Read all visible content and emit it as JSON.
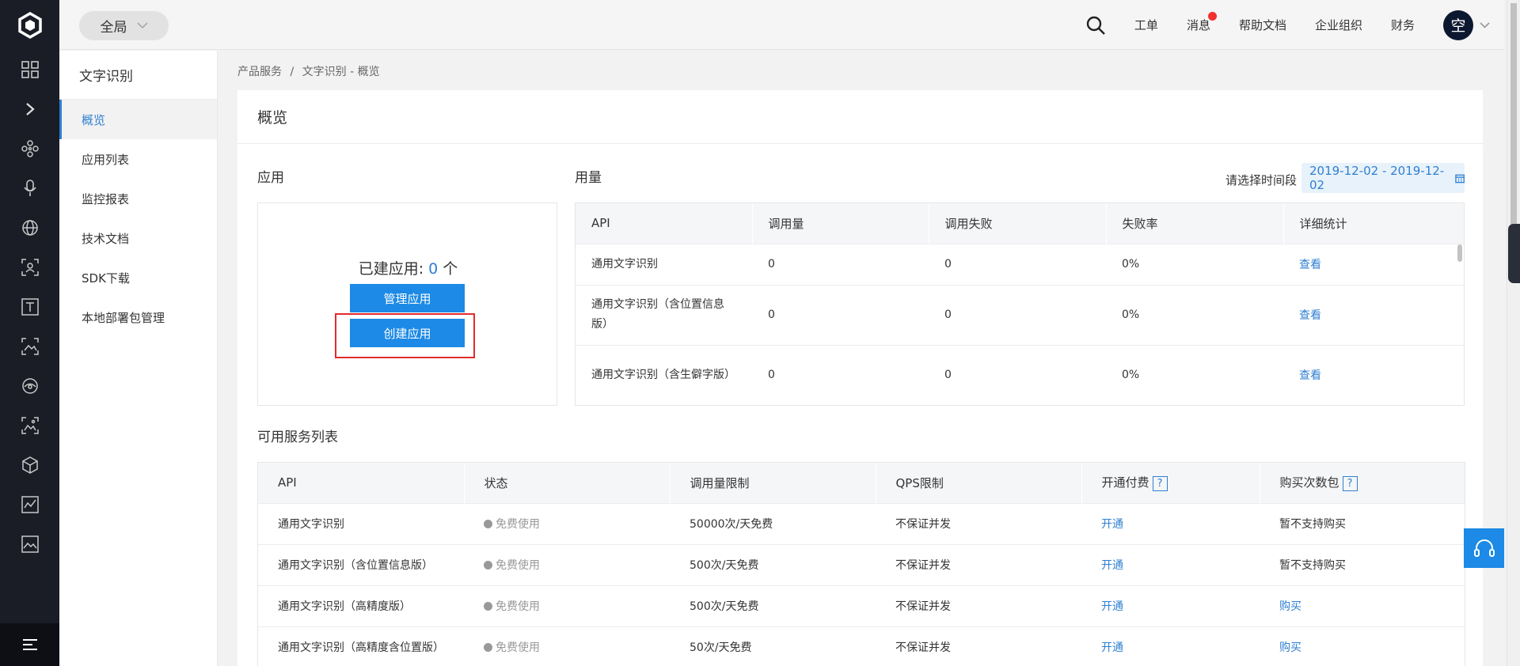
{
  "topbar": {
    "scope_label": "全局",
    "nav": [
      "工单",
      "消息",
      "帮助文档",
      "企业组织",
      "财务"
    ],
    "avatar_text": "空"
  },
  "leftbar": {
    "icons": [
      "grid-icon",
      "expand-icon",
      "network-icon",
      "microphone-icon",
      "globe-icon",
      "face-scan-icon",
      "text-icon",
      "image-recognition-icon",
      "eye-scan-icon",
      "photo-scan-icon",
      "cube-icon",
      "chart-icon",
      "landscape-icon"
    ],
    "bottom_icon": "menu-icon"
  },
  "sidenav": {
    "title": "文字识别",
    "items": [
      "概览",
      "应用列表",
      "监控报表",
      "技术文档",
      "SDK下载",
      "本地部署包管理"
    ]
  },
  "breadcrumb": {
    "items": [
      "产品服务",
      "文字识别 - 概览"
    ],
    "separator": "/"
  },
  "overview": {
    "title": "概览",
    "app_section_title": "应用",
    "app_count_prefix": "已建应用: ",
    "app_count": "0",
    "app_count_suffix": " 个",
    "manage_btn": "管理应用",
    "create_btn": "创建应用",
    "usage_section_title": "用量",
    "date_label": "请选择时间段",
    "date_range": "2019-12-02 - 2019-12-02",
    "usage_headers": [
      "API",
      "调用量",
      "调用失败",
      "失败率",
      "详细统计"
    ],
    "usage_rows": [
      {
        "api": "通用文字识别",
        "calls": "0",
        "fails": "0",
        "rate": "0%",
        "link": "查看"
      },
      {
        "api": "通用文字识别（含位置信息版）",
        "calls": "0",
        "fails": "0",
        "rate": "0%",
        "link": "查看"
      },
      {
        "api": "通用文字识别（含生僻字版）",
        "calls": "0",
        "fails": "0",
        "rate": "0%",
        "link": "查看"
      }
    ],
    "services_title": "可用服务列表",
    "service_headers": [
      "API",
      "状态",
      "调用量限制",
      "QPS限制",
      "开通付费",
      "购买次数包"
    ],
    "help_mark": "?",
    "service_rows": [
      {
        "api": "通用文字识别",
        "status": "免费使用",
        "limit": "50000次/天免费",
        "qps": "不保证并发",
        "open": "开通",
        "buy": "暂不支持购买",
        "buy_link": false
      },
      {
        "api": "通用文字识别（含位置信息版）",
        "status": "免费使用",
        "limit": "500次/天免费",
        "qps": "不保证并发",
        "open": "开通",
        "buy": "暂不支持购买",
        "buy_link": false
      },
      {
        "api": "通用文字识别（高精度版）",
        "status": "免费使用",
        "limit": "500次/天免费",
        "qps": "不保证并发",
        "open": "开通",
        "buy": "购买",
        "buy_link": true
      },
      {
        "api": "通用文字识别（高精度含位置版）",
        "status": "免费使用",
        "limit": "50次/天免费",
        "qps": "不保证并发",
        "open": "开通",
        "buy": "购买",
        "buy_link": true
      }
    ]
  },
  "colors": {
    "accent": "#1c8ae6",
    "link": "#2f7fd1",
    "highlight": "#e32b2b",
    "sidebar_bg": "#1a1d26"
  },
  "float_button_icon": "headset-icon"
}
